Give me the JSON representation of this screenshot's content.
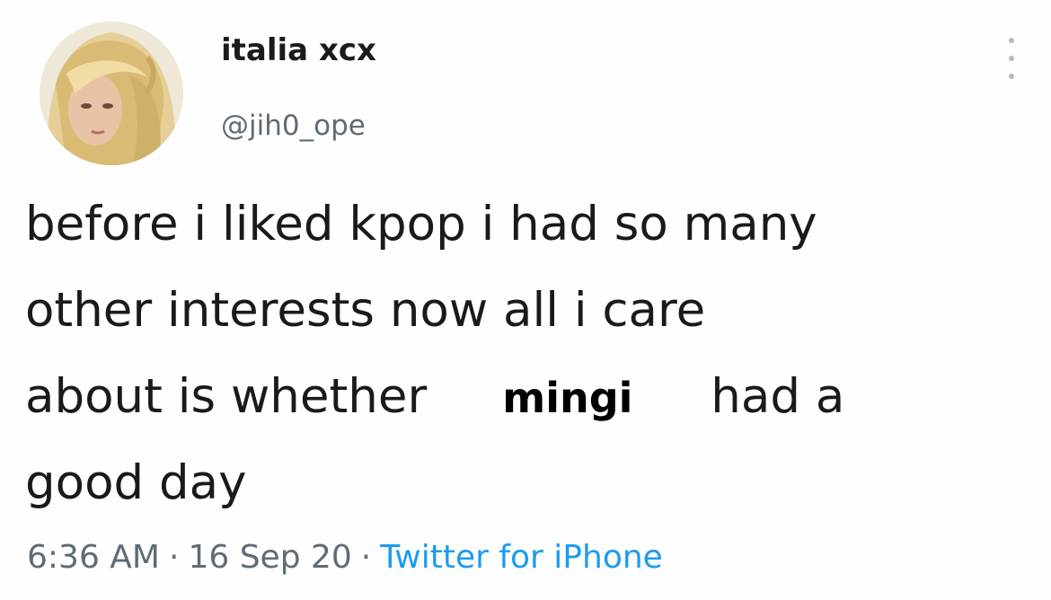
{
  "user": {
    "display_name": "italia xcx",
    "handle": "@jih0_ope"
  },
  "tweet": {
    "line1": "before i liked kpop i had so many",
    "line2": "other interests now all i care",
    "line3_start": "about is whether",
    "highlighted_name": "mingi",
    "line3_end": "had a",
    "line4": "good day"
  },
  "meta": {
    "time": "6:36 AM",
    "separator": "·",
    "date": "16 Sep 20",
    "source": "Twitter for iPhone"
  },
  "icons": {
    "more": "more-vertical-icon",
    "avatar": "profile-photo"
  },
  "colors": {
    "source_link": "#1d9bf0",
    "secondary_text": "#5f6b75"
  }
}
